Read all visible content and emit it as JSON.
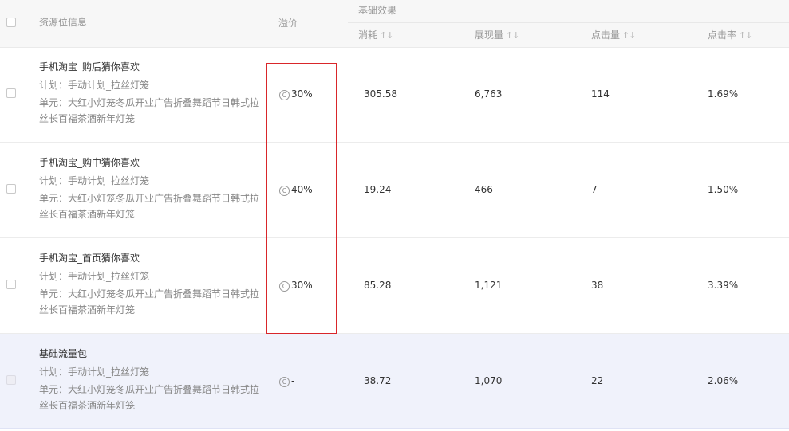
{
  "header": {
    "resource_info": "资源位信息",
    "premium": "溢价",
    "basic_effect": "基础效果",
    "columns": {
      "spend": "消耗",
      "impressions": "展现量",
      "clicks": "点击量",
      "ctr": "点击率"
    },
    "sort_icon": "sort-icon"
  },
  "rows": [
    {
      "title": "手机淘宝_购后猜你喜欢",
      "plan": "计划：手动计划_拉丝灯笼",
      "unit": "单元：大红小灯笼冬瓜开业广告折叠舞蹈节日韩式拉丝长百福茶酒新年灯笼",
      "premium": "30%",
      "spend": "305.58",
      "impressions": "6,763",
      "clicks": "114",
      "ctr": "1.69%"
    },
    {
      "title": "手机淘宝_购中猜你喜欢",
      "plan": "计划：手动计划_拉丝灯笼",
      "unit": "单元：大红小灯笼冬瓜开业广告折叠舞蹈节日韩式拉丝长百福茶酒新年灯笼",
      "premium": "40%",
      "spend": "19.24",
      "impressions": "466",
      "clicks": "7",
      "ctr": "1.50%"
    },
    {
      "title": "手机淘宝_首页猜你喜欢",
      "plan": "计划：手动计划_拉丝灯笼",
      "unit": "单元：大红小灯笼冬瓜开业广告折叠舞蹈节日韩式拉丝长百福茶酒新年灯笼",
      "premium": "30%",
      "spend": "85.28",
      "impressions": "1,121",
      "clicks": "38",
      "ctr": "3.39%"
    },
    {
      "title": "基础流量包",
      "plan": "计划：手动计划_拉丝灯笼",
      "unit": "单元：大红小灯笼冬瓜开业广告折叠舞蹈节日韩式拉丝长百福茶酒新年灯笼",
      "premium": "-",
      "spend": "38.72",
      "impressions": "1,070",
      "clicks": "22",
      "ctr": "2.06%"
    }
  ],
  "colors": {
    "header_bg": "#f7f7f7",
    "alt_row_bg": "#f0f2fb",
    "highlight_border": "#d9262a"
  }
}
